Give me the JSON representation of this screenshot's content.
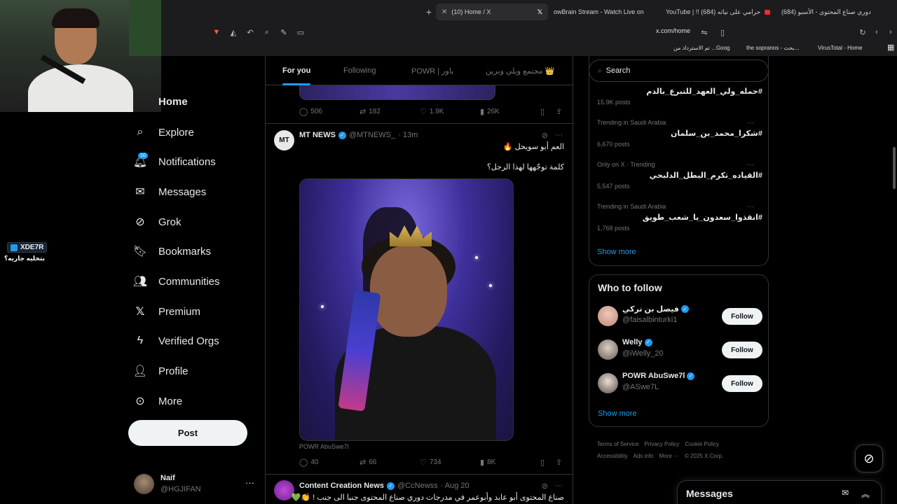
{
  "browser": {
    "tabs": [
      {
        "label": "(10) Home / X",
        "active": true
      },
      {
        "label": "owBrain Stream - Watch Live on"
      },
      {
        "label": "YouTube | !! (684) حرامي على نياته"
      },
      {
        "label": "(684) دوري صناع المحتوى - الأسبو"
      }
    ],
    "url": "x.com/home",
    "bookmarks": [
      "VirusTotal - Home",
      "the sopranos - بحث...",
      "تم الاسترداد من ...Goog"
    ]
  },
  "stream_overlay": {
    "name": "XDE7R",
    "subtitle": "بتخليه جاريه؟"
  },
  "nav": {
    "home": "Home",
    "explore": "Explore",
    "notifications": "Notifications",
    "notifications_badge": "10",
    "messages": "Messages",
    "grok": "Grok",
    "bookmarks": "Bookmarks",
    "communities": "Communities",
    "premium": "Premium",
    "verified_orgs": "Verified Orgs",
    "profile": "Profile",
    "more": "More",
    "post": "Post"
  },
  "account": {
    "name": "Naif",
    "handle": "@HGJIFAN"
  },
  "feed_tabs": [
    {
      "label": "For you",
      "active": true
    },
    {
      "label": "Following"
    },
    {
      "label": "POWR | باور"
    },
    {
      "label": "مجتمع ويلي وبرين 👑"
    }
  ],
  "prev_tweet_actions": {
    "replies": "506",
    "reposts": "182",
    "likes": "1.9K",
    "views": "26K"
  },
  "tweet": {
    "author": "MT NEWS",
    "handle": "@MTNEWS_",
    "time": "· 13m",
    "line1": "العم أبو سويحل 🔥",
    "line2": "كلمة توجّهها لهذا الرجل؟",
    "credit": "POWR AbuSwe7l",
    "replies": "40",
    "reposts": "66",
    "likes": "734",
    "views": "8K"
  },
  "next_tweet": {
    "author": "Content Creation News",
    "handle": "@CcNewss",
    "time": "· Aug 20",
    "text": "صناع المحتوى أبو عابد وأبوعمر في مدرجات دوري صناع المحتوى جنبا الى جنب ! 👏💚"
  },
  "search": {
    "placeholder": "Search"
  },
  "trends": [
    {
      "context": "",
      "title": "#حمله_ولي_العهد_للتبرع_بالدم",
      "posts": "15.9K posts"
    },
    {
      "context": "Trending in Saudi Arabia",
      "title": "#شكرا_محمد_بن_سلمان",
      "posts": "6,670 posts"
    },
    {
      "context": "Only on X · Trending",
      "title": "#القياده_تكرم_البطل_الدلبحي",
      "posts": "5,547 posts"
    },
    {
      "context": "Trending in Saudi Arabia",
      "title": "#انقذوا_سعدون_يا_شعب_طويق",
      "posts": "1,768 posts"
    }
  ],
  "trends_show_more": "Show more",
  "who_to_follow": {
    "title": "Who to follow",
    "users": [
      {
        "name": "فيصل بن تركي",
        "handle": "@faisalbinturki1",
        "button": "Follow"
      },
      {
        "name": "Welly",
        "handle": "@iWelly_20",
        "button": "Follow"
      },
      {
        "name": "POWR AbuSwe7l",
        "handle": "@ASwe7L",
        "button": "Follow"
      }
    ],
    "show_more": "Show more"
  },
  "footer": {
    "terms": "Terms of Service",
    "privacy": "Privacy Policy",
    "cookie": "Cookie Policy",
    "accessibility": "Accessibility",
    "ads": "Ads info",
    "more": "More ···",
    "copyright": "© 2025 X Corp."
  },
  "messages_drawer": {
    "title": "Messages"
  },
  "colors": {
    "accent": "#1d9bf0",
    "background": "#000000",
    "text": "#e7e9ea",
    "muted": "#71767b"
  }
}
